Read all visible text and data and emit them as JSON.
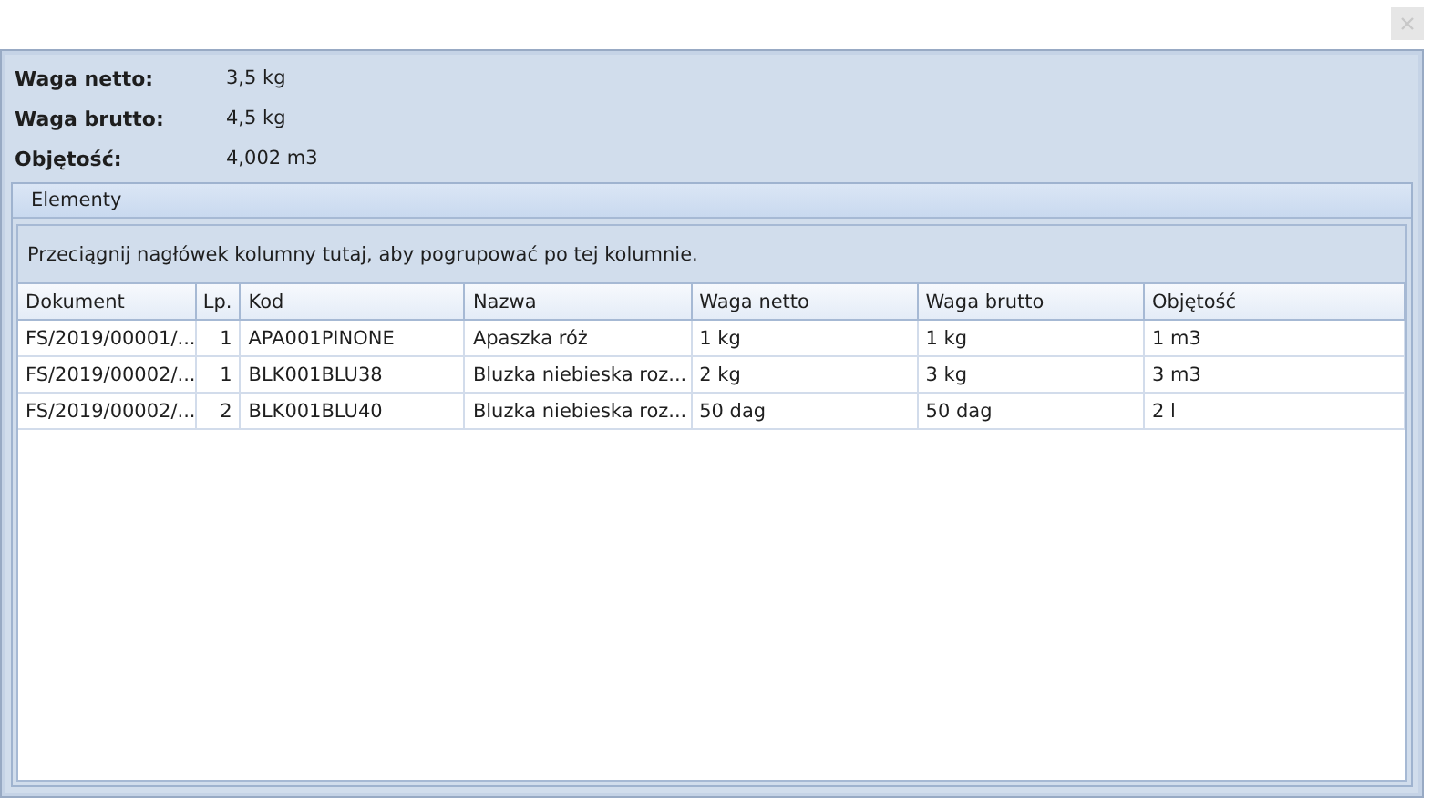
{
  "summary": [
    {
      "label": "Waga netto:",
      "value": "3,5 kg"
    },
    {
      "label": "Waga brutto:",
      "value": "4,5 kg"
    },
    {
      "label": "Objętość:",
      "value": "4,002 m3"
    }
  ],
  "group": {
    "title": "Elementy",
    "hint": "Przeciągnij nagłówek kolumny tutaj, aby pogrupować po tej kolumnie."
  },
  "table": {
    "columns": [
      "Dokument",
      "Lp.",
      "Kod",
      "Nazwa",
      "Waga netto",
      "Waga brutto",
      "Objętość"
    ],
    "rows": [
      [
        "FS/2019/00001/...",
        "1",
        "APA001PINONE",
        "Apaszka róż",
        "1 kg",
        "1 kg",
        "1 m3"
      ],
      [
        "FS/2019/00002/...",
        "1",
        "BLK001BLU38",
        "Bluzka niebieska roz...",
        "2 kg",
        "3 kg",
        "3 m3"
      ],
      [
        "FS/2019/00002/...",
        "2",
        "BLK001BLU40",
        "Bluzka niebieska roz...",
        "50 dag",
        "50 dag",
        "2 l"
      ]
    ]
  }
}
